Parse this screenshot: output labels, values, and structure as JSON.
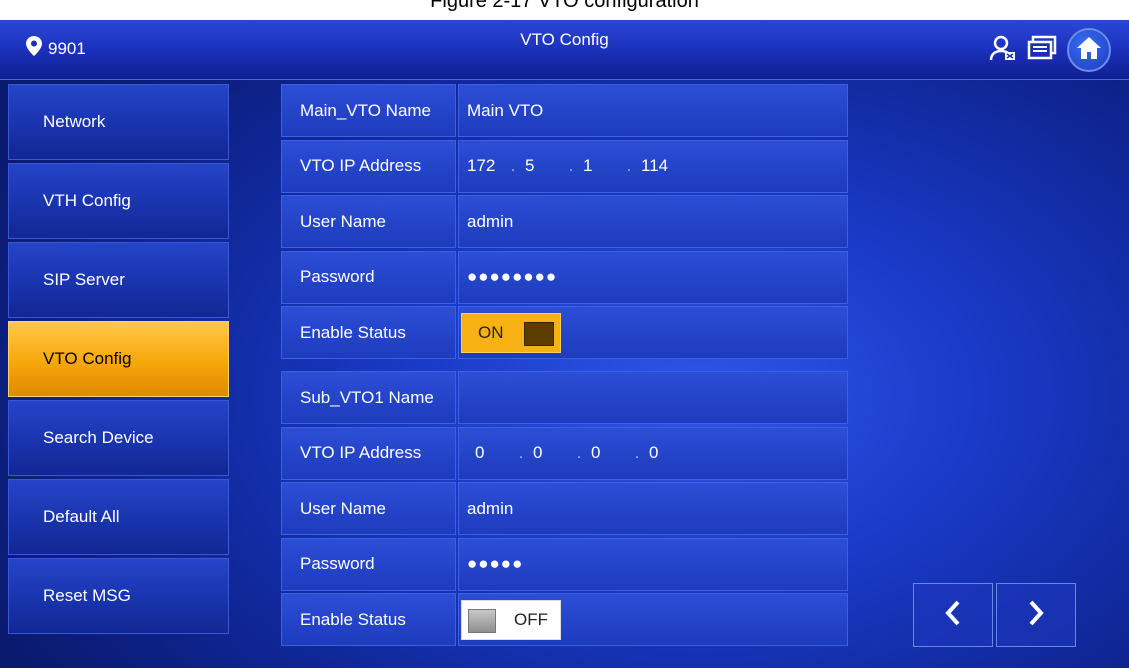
{
  "caption": "Figure 2-17 VTO configuration",
  "header": {
    "room_number": "9901",
    "title": "VTO Config"
  },
  "sidebar": {
    "items": [
      {
        "label": "Network"
      },
      {
        "label": "VTH Config"
      },
      {
        "label": "SIP Server"
      },
      {
        "label": "VTO Config",
        "active": true
      },
      {
        "label": "Search Device"
      },
      {
        "label": "Default All"
      },
      {
        "label": "Reset MSG"
      }
    ]
  },
  "main_vto": {
    "name_label": "Main_VTO Name",
    "name_value": "Main VTO",
    "ip_label": "VTO IP Address",
    "ip": [
      "172",
      "5",
      "1",
      "114"
    ],
    "user_label": "User Name",
    "user_value": "admin",
    "password_label": "Password",
    "password_value": "●●●●●●●●",
    "status_label": "Enable Status",
    "status_value": "ON"
  },
  "sub_vto1": {
    "name_label": "Sub_VTO1 Name",
    "name_value": "",
    "ip_label": "VTO IP Address",
    "ip": [
      "0",
      "0",
      "0",
      "0"
    ],
    "user_label": "User Name",
    "user_value": "admin",
    "password_label": "Password",
    "password_value": "●●●●●",
    "status_label": "Enable Status",
    "status_value": "OFF"
  },
  "colors": {
    "accent": "#f7a60a",
    "background": "#1a3bc9"
  }
}
